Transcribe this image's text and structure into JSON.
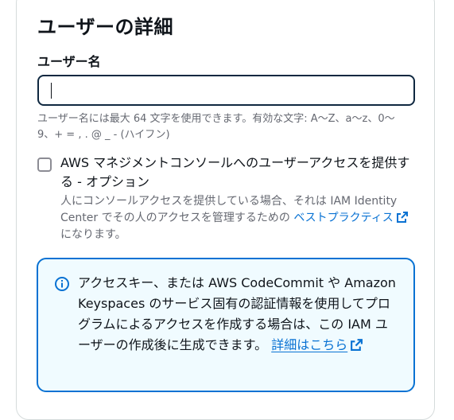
{
  "section": {
    "title": "ユーザーの詳細"
  },
  "username": {
    "label": "ユーザー名",
    "value": "",
    "hint": "ユーザー名には最大 64 文字を使用できます。有効な文字: A～Z、a～z、0～9、+ = , . @ _ - (ハイフン)"
  },
  "console_access": {
    "checked": false,
    "label": "AWS マネジメントコンソールへのユーザーアクセスを提供する - オプション",
    "description_before": "人にコンソールアクセスを提供している場合、それは IAM Identity Center でその人のアクセスを管理するための ",
    "link_text": "ベストプラクティス",
    "description_after": " になります。"
  },
  "info_alert": {
    "text": "アクセスキー、または AWS CodeCommit や Amazon Keyspaces のサービス固有の認証情報を使用してプログラムによるアクセスを作成する場合は、この IAM ユーザーの作成後に生成できます。",
    "link_text": "詳細はこちら"
  },
  "colors": {
    "link": "#0972d3",
    "info_background": "#f0fbff",
    "input_border": "#0f2840"
  }
}
